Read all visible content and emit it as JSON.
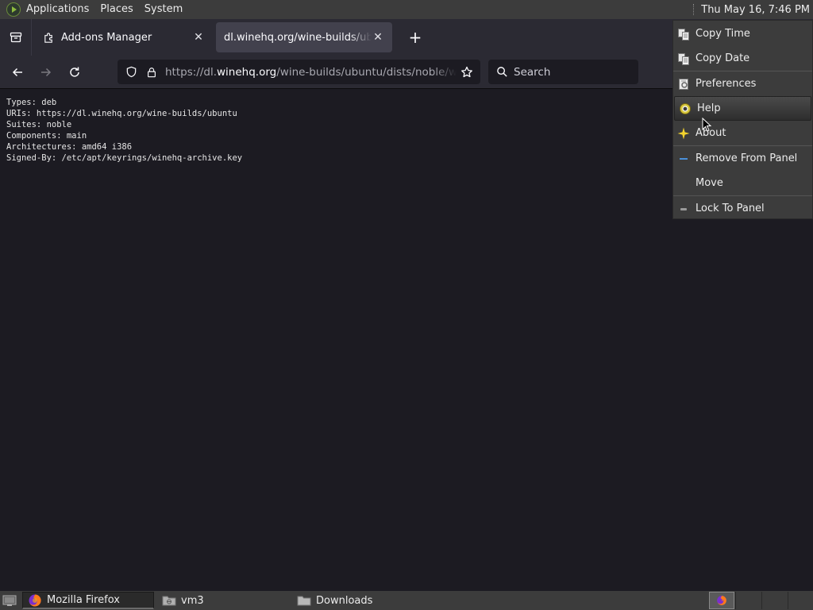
{
  "top_panel": {
    "applications": "Applications",
    "places": "Places",
    "system": "System",
    "clock": "Thu May 16,  7:46 PM"
  },
  "tabs": [
    {
      "title": "Add-ons Manager",
      "icon": "puzzle-icon",
      "active": false
    },
    {
      "title": "dl.winehq.org/wine-builds/ubuntu/dists/noble/winehq-noble.sources",
      "icon": "none",
      "active": true
    }
  ],
  "navbar": {
    "url_scheme": "https://dl.",
    "url_host": "winehq.org",
    "url_path": "/wine-builds/ubuntu/dists/noble/winehq-noble.sources",
    "search_placeholder": "Search"
  },
  "content": {
    "lines": [
      "Types: deb",
      "URIs: https://dl.winehq.org/wine-builds/ubuntu",
      "Suites: noble",
      "Components: main",
      "Architectures: amd64 i386",
      "Signed-By: /etc/apt/keyrings/winehq-archive.key"
    ]
  },
  "context_menu": {
    "items": [
      {
        "label": "Copy Time",
        "icon": "copy-icon"
      },
      {
        "label": "Copy Date",
        "icon": "copy-icon"
      },
      {
        "label": "Preferences",
        "icon": "preferences-icon"
      },
      {
        "label": "Help",
        "icon": "help-icon",
        "highlighted": true
      },
      {
        "label": "About",
        "icon": "about-icon"
      },
      {
        "label": "Remove From Panel",
        "icon": "remove-icon"
      },
      {
        "label": "Move",
        "icon": "none"
      },
      {
        "label": "Lock To Panel",
        "icon": "lock-icon"
      }
    ]
  },
  "taskbar": {
    "tasks": [
      {
        "label": "Mozilla Firefox",
        "icon": "firefox-icon",
        "active": true
      },
      {
        "label": "vm3",
        "icon": "network-folder-icon",
        "active": false
      },
      {
        "label": "Downloads",
        "icon": "folder-icon",
        "active": false
      }
    ]
  },
  "colors": {
    "panel_bg": "#3c3c3c",
    "browser_chrome": "#2b2a33",
    "page_bg": "#1c1b22",
    "active_tab": "#42414d"
  }
}
